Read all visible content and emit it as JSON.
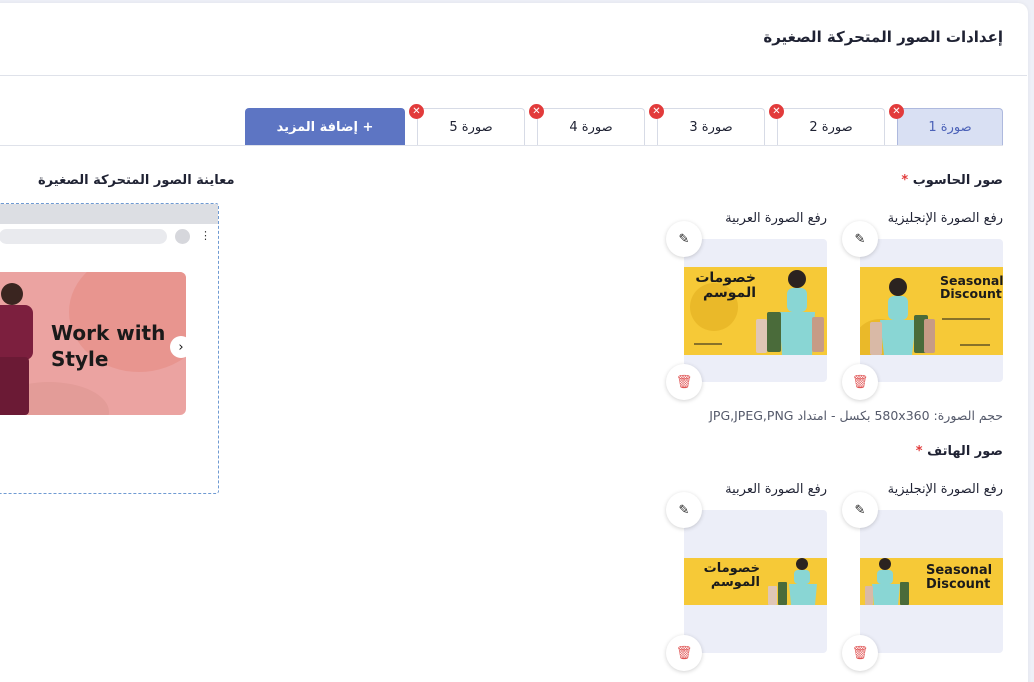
{
  "page": {
    "title": "إعدادات الصور المتحركة الصغيرة"
  },
  "tabs": [
    {
      "label": "صورة 1",
      "active": true
    },
    {
      "label": "صورة 2",
      "active": false
    },
    {
      "label": "صورة 3",
      "active": false
    },
    {
      "label": "صورة 4",
      "active": false
    },
    {
      "label": "صورة 5",
      "active": false
    }
  ],
  "add_more_label": "+ إضافة المزيد",
  "remove_icon": "close-icon",
  "desktop": {
    "section_label": "صور الحاسوب",
    "required_mark": "*",
    "english_label": "رفع الصورة الإنجليزية",
    "arabic_label": "رفع الصورة العربية",
    "english_banner_text": "Seasonal Discount",
    "arabic_banner_text": "خصومات الموسم",
    "hint": "حجم الصورة: 580x360 بكسل - امتداد JPG,JPEG,PNG"
  },
  "mobile": {
    "section_label": "صور الهاتف",
    "required_mark": "*",
    "english_label": "رفع الصورة الإنجليزية",
    "arabic_label": "رفع الصورة العربية",
    "english_banner_text": "Seasonal Discount",
    "arabic_banner_text": "خصومات الموسم"
  },
  "preview": {
    "title": "معاينة الصور المتحركة الصغيرة",
    "hero_text": "Work with Style",
    "next_icon": "chevron-right-icon"
  },
  "colors": {
    "accent": "#5d75c3",
    "active_tab_bg": "#d9e0f3",
    "danger": "#e23b3b",
    "banner_yellow": "#f6c937",
    "preview_pink": "#eba3a1"
  }
}
